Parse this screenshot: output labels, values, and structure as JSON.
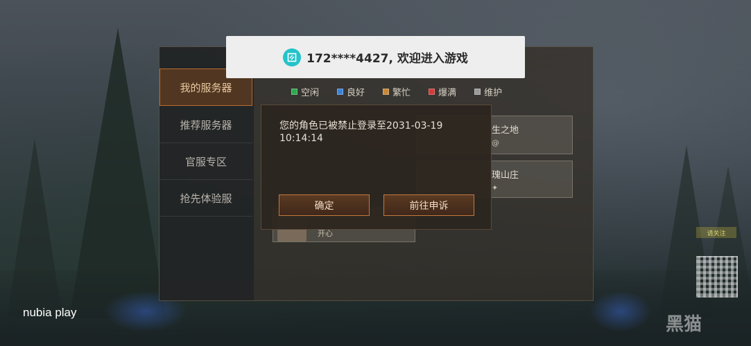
{
  "toast": {
    "message": "172****4427, 欢迎进入游戏",
    "logo_icon": "coupon-icon",
    "logo_color": "#24c3c9"
  },
  "sidebar": {
    "items": [
      {
        "label": "我的服务器",
        "active": true
      },
      {
        "label": "推荐服务器",
        "active": false
      },
      {
        "label": "官服专区",
        "active": false
      },
      {
        "label": "抢先体验服",
        "active": false
      }
    ]
  },
  "legend": [
    {
      "label": "空闲",
      "color": "#2fa84f"
    },
    {
      "label": "良好",
      "color": "#3b82d6"
    },
    {
      "label": "繁忙",
      "color": "#c88a3a"
    },
    {
      "label": "爆满",
      "color": "#d23a3a"
    },
    {
      "label": "维护",
      "color": "#9a9a9a"
    }
  ],
  "servers": {
    "card1": {
      "name": "生之地",
      "sub": "@"
    },
    "card2": {
      "name": "瑰山庄",
      "sub": "✦"
    },
    "card3": {
      "name": "",
      "sub": "开心"
    }
  },
  "dialog": {
    "message": "您的角色已被禁止登录至2031-03-19 10:14:14",
    "confirm_label": "确定",
    "appeal_label": "前往申诉"
  },
  "watermark": "nubia play",
  "qr_label": "请关注",
  "brand_logo": "黑猫"
}
